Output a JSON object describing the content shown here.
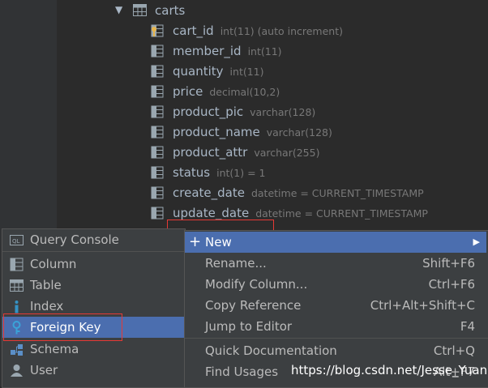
{
  "tree": {
    "table_name": "carts",
    "columns": [
      {
        "name": "cart_id",
        "type": "int(11) (auto increment)",
        "icon": "primary-key-column-icon"
      },
      {
        "name": "member_id",
        "type": "int(11)",
        "icon": "column-icon"
      },
      {
        "name": "quantity",
        "type": "int(11)",
        "icon": "column-icon"
      },
      {
        "name": "price",
        "type": "decimal(10,2)",
        "icon": "column-icon"
      },
      {
        "name": "product_pic",
        "type": "varchar(128)",
        "icon": "column-icon"
      },
      {
        "name": "product_name",
        "type": "varchar(128)",
        "icon": "column-icon"
      },
      {
        "name": "product_attr",
        "type": "varchar(255)",
        "icon": "column-icon"
      },
      {
        "name": "status",
        "type": "int(1) = 1",
        "icon": "column-icon"
      },
      {
        "name": "create_date",
        "type": "datetime = CURRENT_TIMESTAMP",
        "icon": "column-icon"
      },
      {
        "name": "update_date",
        "type": "datetime = CURRENT_TIMESTAMP",
        "icon": "column-icon"
      }
    ]
  },
  "new_submenu": {
    "items": [
      {
        "label": "Query Console",
        "icon": "query-console-icon",
        "selected": false
      },
      {
        "label": "Column",
        "icon": "column-icon",
        "selected": false
      },
      {
        "label": "Table",
        "icon": "table-icon",
        "selected": false
      },
      {
        "label": "Index",
        "icon": "index-icon",
        "selected": false
      },
      {
        "label": "Foreign Key",
        "icon": "foreign-key-icon",
        "selected": true
      },
      {
        "label": "Schema",
        "icon": "schema-icon",
        "selected": false
      },
      {
        "label": "User",
        "icon": "user-icon",
        "selected": false
      }
    ]
  },
  "context_menu": {
    "items": [
      {
        "label": "New",
        "shortcut": "",
        "selected": true,
        "submenu": true
      },
      {
        "label": "Rename...",
        "shortcut": "Shift+F6"
      },
      {
        "label": "Modify Column...",
        "shortcut": "Ctrl+F6"
      },
      {
        "label": "Copy Reference",
        "shortcut": "Ctrl+Alt+Shift+C"
      },
      {
        "label": "Jump to Editor",
        "shortcut": "F4"
      },
      {
        "label": "Quick Documentation",
        "shortcut": "Ctrl+Q"
      },
      {
        "label": "Find Usages",
        "shortcut": "Alt+F7"
      }
    ]
  },
  "watermark": "https://blog.csdn.net/Jesse_Yuan",
  "colors": {
    "selection": "#4b6eaf",
    "highlight_box": "#e53935"
  }
}
